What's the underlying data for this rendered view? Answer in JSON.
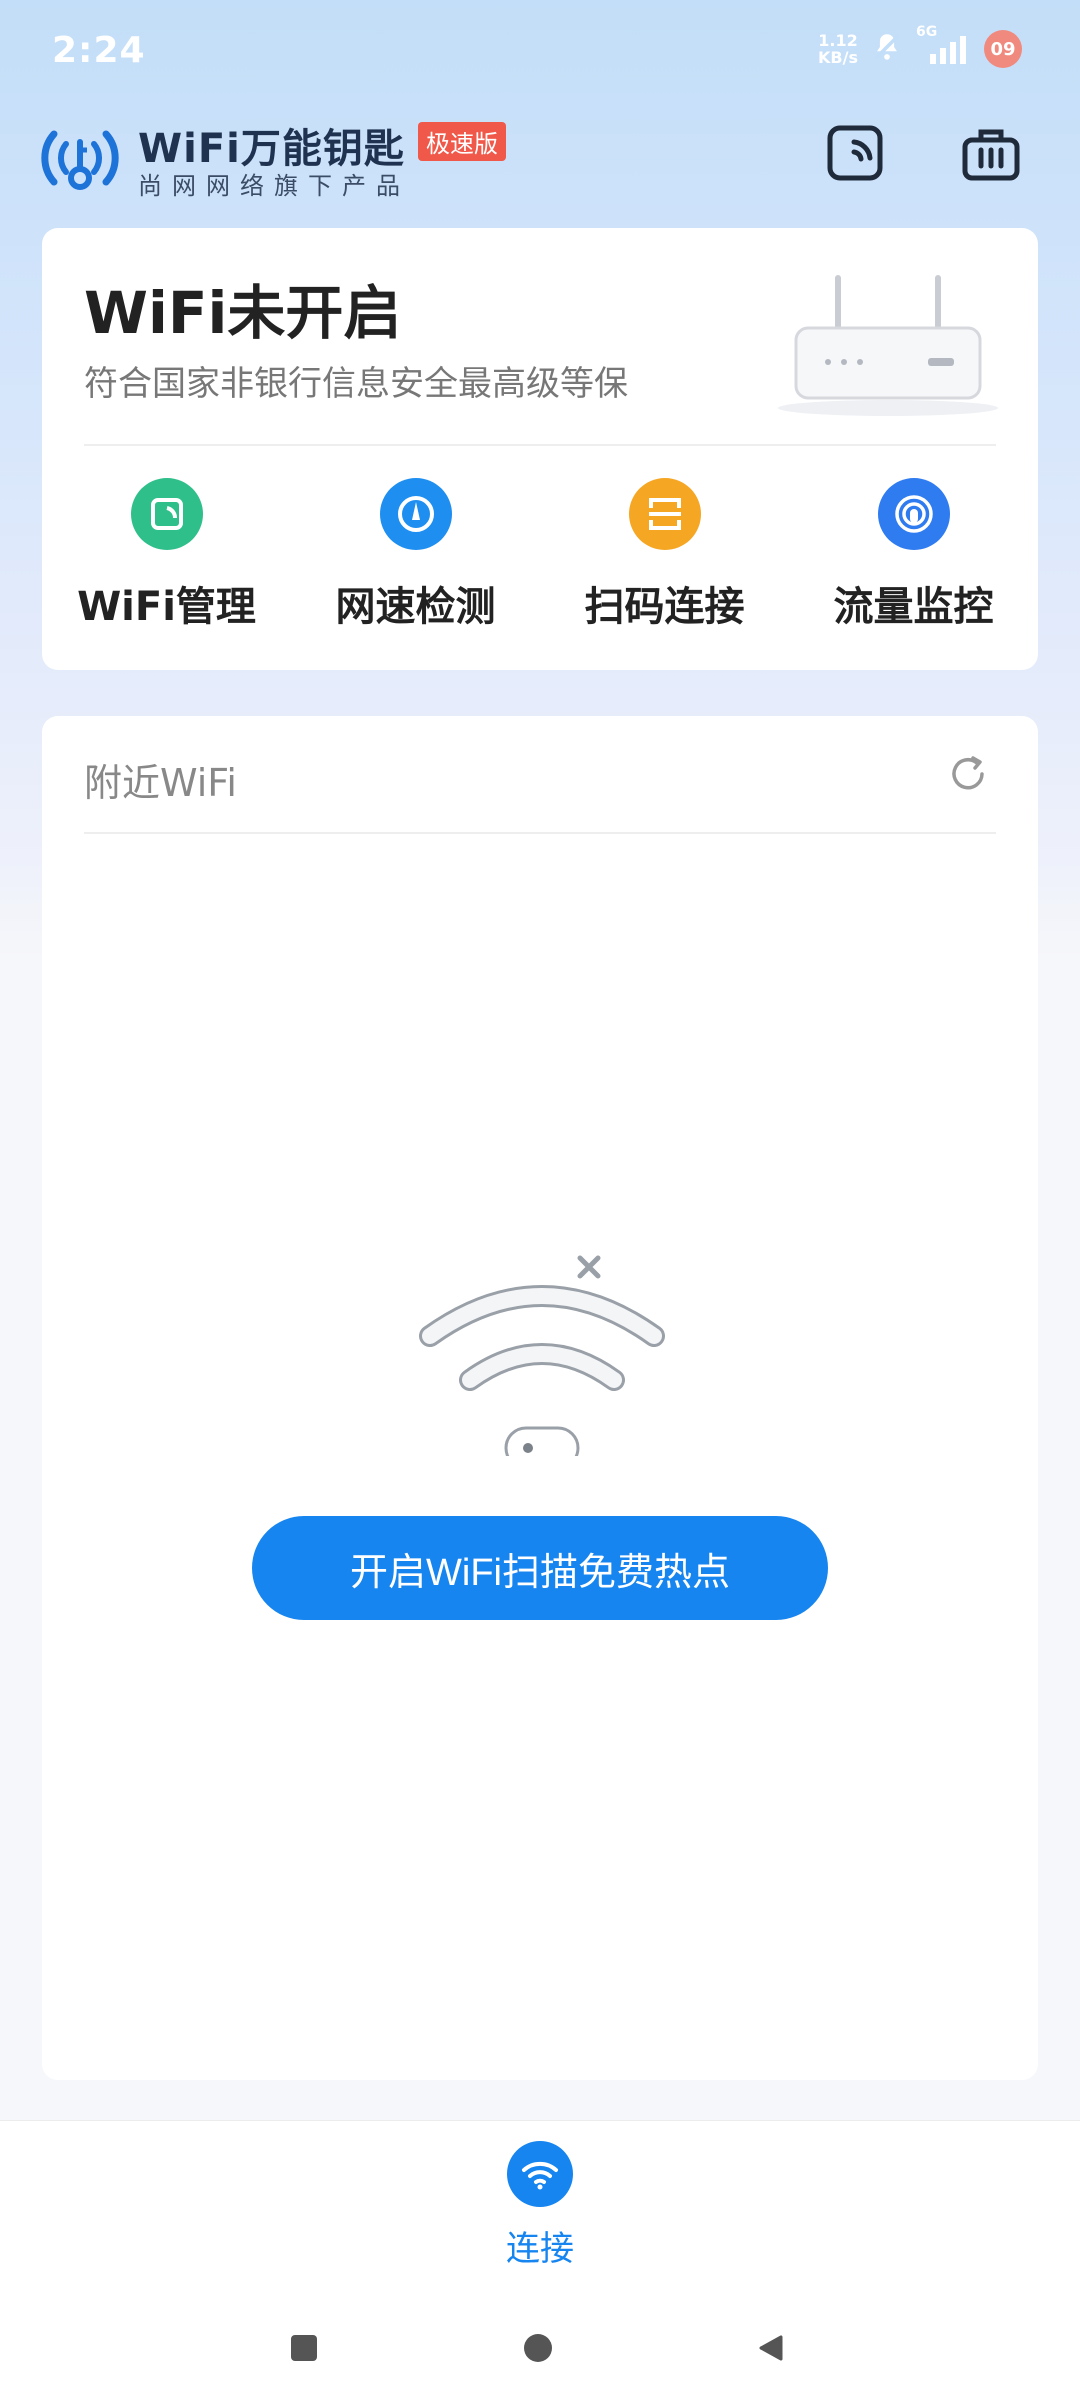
{
  "status_bar": {
    "time": "2:24",
    "net_speed_value": "1.12",
    "net_speed_unit": "KB/s",
    "signal_label": "6G",
    "notification_count": "09"
  },
  "header": {
    "app_name": "WiFi万能钥匙",
    "badge": "极速版",
    "subtitle": "尚网网络旗下产品"
  },
  "status_card": {
    "title": "WiFi未开启",
    "subtitle": "符合国家非银行信息安全最高级等保",
    "tools": [
      {
        "label": "WiFi管理",
        "color": "#2fbf8a",
        "icon": "wifi-manage-icon"
      },
      {
        "label": "网速检测",
        "color": "#1e8ff0",
        "icon": "speedometer-icon"
      },
      {
        "label": "扫码连接",
        "color": "#f5a623",
        "icon": "scan-icon"
      },
      {
        "label": "流量监控",
        "color": "#2f7bf0",
        "icon": "traffic-monitor-icon"
      }
    ]
  },
  "nearby": {
    "title": "附近WiFi",
    "enable_button": "开启WiFi扫描免费热点"
  },
  "bottom_nav": {
    "items": [
      {
        "label": "连接",
        "active": true,
        "color": "#1785f0"
      }
    ]
  }
}
